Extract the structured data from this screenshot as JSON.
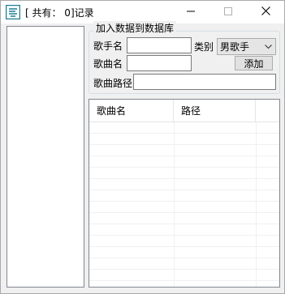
{
  "window": {
    "title": "[ 共有： 0]记录"
  },
  "icons": {
    "app": "app-icon",
    "minimize": "minimize-icon",
    "maximize": "maximize-icon",
    "close": "close-icon",
    "dropdown": "chevron-down-icon"
  },
  "form": {
    "group_title": "加入数据到数据库",
    "singer_label": "歌手名",
    "singer_value": "",
    "song_label": "歌曲名",
    "song_value": "",
    "category_label": "类别",
    "category_selected": "男歌手",
    "add_button": "添加",
    "path_label": "歌曲路径",
    "path_value": ""
  },
  "table": {
    "columns": [
      "歌曲名",
      "路径"
    ],
    "rows": []
  },
  "colors": {
    "window_bg": "#f0f0f0",
    "titlebar_bg": "#ffffff",
    "icon_teal": "#1f7f93"
  }
}
